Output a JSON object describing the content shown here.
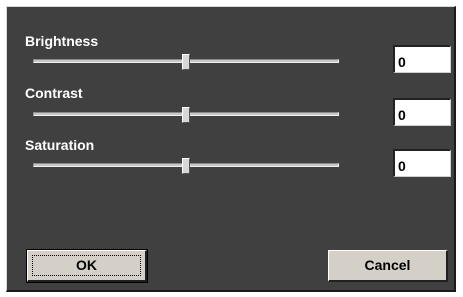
{
  "sliders": [
    {
      "label": "Brightness",
      "value": "0",
      "position_fraction": 0.5
    },
    {
      "label": "Contrast",
      "value": "0",
      "position_fraction": 0.5
    },
    {
      "label": "Saturation",
      "value": "0",
      "position_fraction": 0.5
    }
  ],
  "buttons": {
    "ok_label": "OK",
    "cancel_label": "Cancel"
  },
  "colors": {
    "dialog_background": "#404040",
    "button_face": "#d4d0c8"
  }
}
